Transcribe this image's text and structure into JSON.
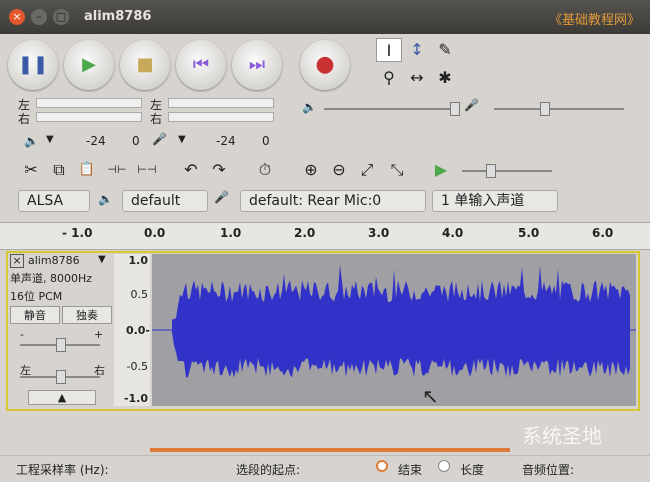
{
  "window": {
    "title": "alim8786",
    "close": "×",
    "minimize": "–",
    "maximize": "□"
  },
  "watermark": "《基础教程网》",
  "watermark2": "系统圣地",
  "transport": {
    "pause": "❚❚",
    "play": "▶",
    "stop": "■",
    "skip_start": "⏮",
    "skip_end": "⏭",
    "record": "●"
  },
  "tools": {
    "select": "I",
    "envelope": "↕",
    "draw": "✎",
    "zoom": "⚲",
    "timeshift": "↔",
    "multi": "✱"
  },
  "meters": {
    "left": "左",
    "right": "右",
    "scale_a": "-24",
    "scale_b": "0",
    "scale_c": "-24",
    "scale_d": "0"
  },
  "edit_tools": {
    "cut": "✂",
    "copy": "⧉",
    "paste": "📋",
    "trim": "⊣⊢",
    "silence": "⊢⊣",
    "undo": "↶",
    "redo": "↷",
    "sync": "⏱",
    "zoom_in": "⊕",
    "zoom_out": "⊖",
    "fit_sel": "⤢",
    "fit": "⤡",
    "play_at_speed": "▶"
  },
  "devices": {
    "host": "ALSA",
    "output": "default",
    "input": "default: Rear Mic:0",
    "channels": "1 单输入声道"
  },
  "ruler": {
    "ticks": [
      "- 1.0",
      "0.0",
      "1.0",
      "2.0",
      "3.0",
      "4.0",
      "5.0",
      "6.0"
    ]
  },
  "track": {
    "name": "alim8786",
    "info1": "单声道, 8000Hz",
    "info2": "16位 PCM",
    "mute": "静音",
    "solo": "独奏",
    "gain_minus": "-",
    "gain_plus": "+",
    "pan_left": "左",
    "pan_right": "右",
    "collapse": "▲"
  },
  "vruler": [
    "1.0",
    "0.5",
    "0.0-",
    "-0.5",
    "-1.0"
  ],
  "status": {
    "rate_label": "工程采样率 (Hz):",
    "sel_start": "选段的起点:",
    "end_label": "结束",
    "length_label": "长度",
    "audio_pos": "音频位置:"
  },
  "colors": {
    "waveform": "#3232c8",
    "track_border": "#d8c830",
    "record": "#c83232"
  }
}
